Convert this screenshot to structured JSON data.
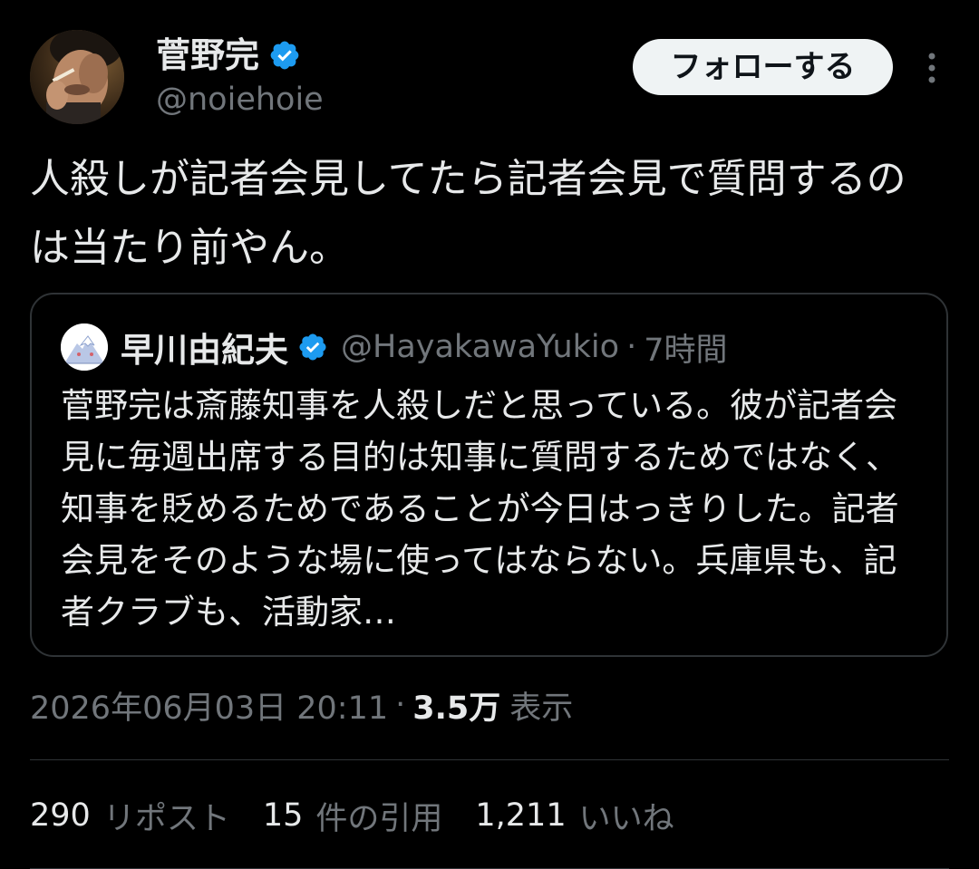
{
  "colors": {
    "background": "#000000",
    "text_primary": "#e7e9ea",
    "text_secondary": "#71767b",
    "verified_blue": "#1d9bf0",
    "border": "#2f3336",
    "follow_button_bg": "#eff3f4"
  },
  "author": {
    "name": "菅野完",
    "handle": "@noiehoie",
    "verified_icon": "verified-badge-icon",
    "avatar": "avatar-photo"
  },
  "header": {
    "follow_label": "フォローする",
    "more_icon": "more-vertical-icon"
  },
  "tweet": {
    "text": "人殺しが記者会見してたら記者会見で質問するのは当たり前やん。"
  },
  "quote": {
    "name": "早川由紀夫",
    "handle": "@HayakawaYukio",
    "separator": "·",
    "time": "7時間",
    "text": "菅野完は斎藤知事を人殺しだと思っている。彼が記者会見に毎週出席する目的は知事に質問するためではなく、知事を貶めるためであることが今日はっきりした。記者会見をそのような場に使ってはならない。兵庫県も、記者クラブも、活動家…",
    "verified_icon": "verified-badge-icon",
    "avatar": "mountain-avatar-icon"
  },
  "meta": {
    "timestamp": "2026年06月03日 20:11",
    "separator": "·",
    "views_count": "3.5万",
    "views_label": "表示"
  },
  "stats": [
    {
      "count": "290",
      "label": "リポスト"
    },
    {
      "count": "15",
      "label": "件の引用"
    },
    {
      "count": "1,211",
      "label": "いいね"
    }
  ]
}
